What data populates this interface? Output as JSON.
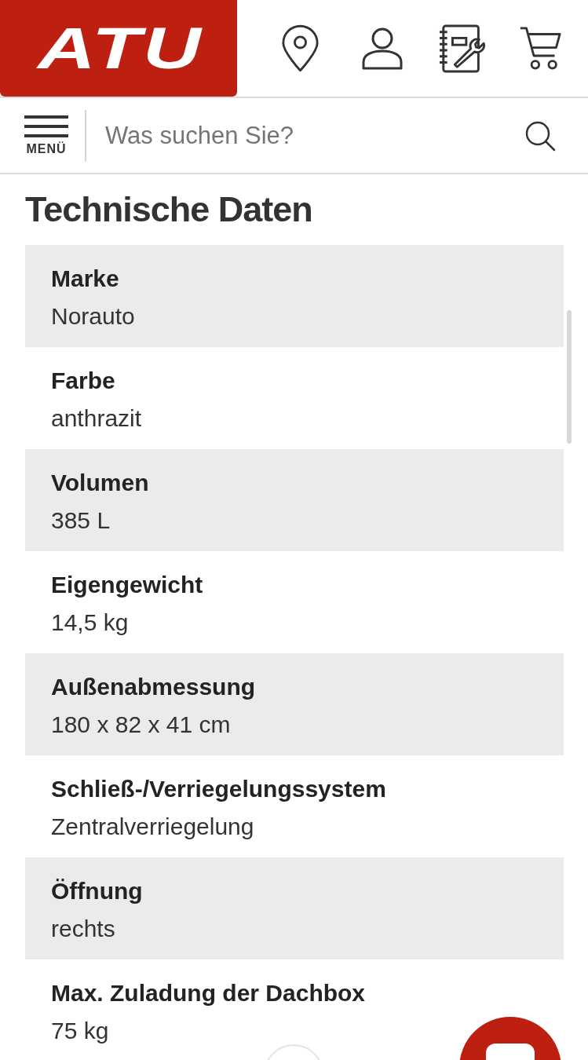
{
  "header": {
    "logo": "ATU"
  },
  "search_bar": {
    "menu_label": "MENÜ",
    "placeholder": "Was suchen Sie?"
  },
  "section": {
    "title": "Technische Daten",
    "specs": [
      {
        "label": "Marke",
        "value": "Norauto"
      },
      {
        "label": "Farbe",
        "value": "anthrazit"
      },
      {
        "label": "Volumen",
        "value": "385 L"
      },
      {
        "label": "Eigengewicht",
        "value": "14,5 kg"
      },
      {
        "label": "Außenabmessung",
        "value": "180 x 82 x 41 cm"
      },
      {
        "label": "Schließ-/Verriegelungssystem",
        "value": "Zentralverriegelung"
      },
      {
        "label": "Öffnung",
        "value": "rechts"
      },
      {
        "label": "Max. Zuladung der Dachbox",
        "value": "75 kg"
      }
    ]
  }
}
